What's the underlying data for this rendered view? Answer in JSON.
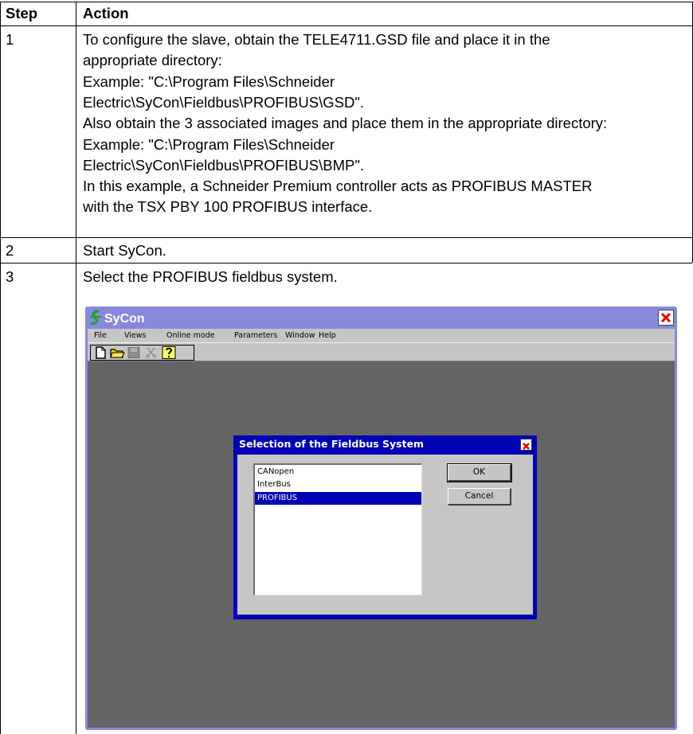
{
  "table": {
    "headers": {
      "step": "Step",
      "action": "Action"
    },
    "rows": [
      {
        "step": "1",
        "lines": [
          "To configure the slave, obtain the TELE4711.GSD file and place it in the",
          "appropriate directory:",
          "Example: \"C:\\Program Files\\Schneider",
          "Electric\\SyCon\\Fieldbus\\PROFIBUS\\GSD\".",
          "Also obtain the 3 associated images and place them in the appropriate directory:",
          "Example: \"C:\\Program Files\\Schneider",
          "Electric\\SyCon\\Fieldbus\\PROFIBUS\\BMP\".",
          "In this example, a Schneider Premium controller acts as PROFIBUS MASTER",
          "with the TSX PBY 100 PROFIBUS interface."
        ]
      },
      {
        "step": "2",
        "lines": [
          "Start SyCon."
        ]
      },
      {
        "step": "3",
        "lines": [
          "Select the PROFIBUS fieldbus system."
        ]
      }
    ]
  },
  "sycon": {
    "window_title": "SyCon",
    "menu": [
      "File",
      "Views",
      "Online mode",
      "Parameters",
      "Window",
      "Help"
    ],
    "toolbar_icons": [
      "new-file-icon",
      "open-folder-icon",
      "save-icon",
      "cut-icon",
      "help-icon"
    ],
    "dialog": {
      "title": "Selection of the Fieldbus System",
      "options": [
        "CANopen",
        "InterBus",
        "PROFIBUS"
      ],
      "selected": "PROFIBUS",
      "ok_label": "OK",
      "cancel_label": "Cancel"
    },
    "colors": {
      "frame": "#8888dd",
      "dialog_title_bar": "#0000b4",
      "workspace": "#646464",
      "close_button": "#dd0000",
      "selection": "#0000b4"
    }
  }
}
